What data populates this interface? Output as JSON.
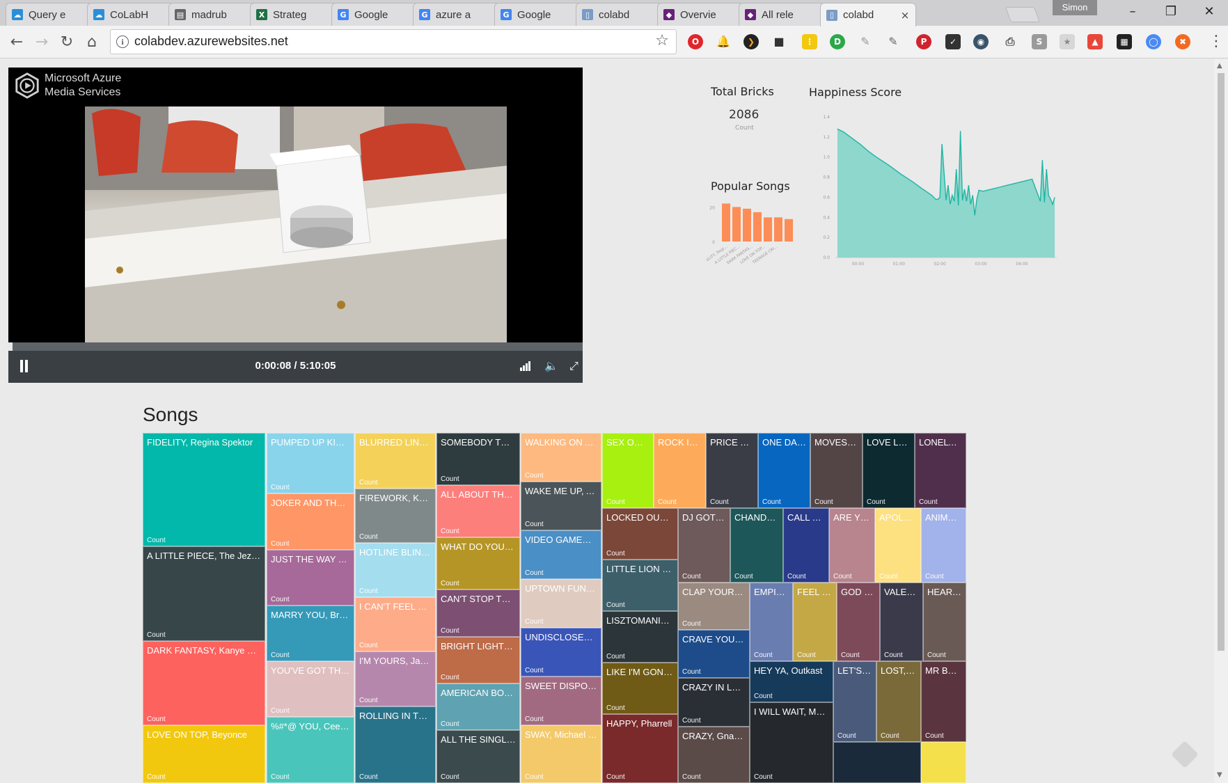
{
  "browser": {
    "tabs": [
      {
        "label": "Query e",
        "icon": "cloud-icon",
        "color": "#2a8fd8"
      },
      {
        "label": "CoLabH",
        "icon": "cloud-icon",
        "color": "#2a8fd8"
      },
      {
        "label": "madrub",
        "icon": "doc-icon",
        "color": "#666666"
      },
      {
        "label": "Strateg",
        "icon": "excel-icon",
        "color": "#1e7145"
      },
      {
        "label": "Google",
        "icon": "google-icon",
        "color": "#4285f4"
      },
      {
        "label": "azure a",
        "icon": "google-icon",
        "color": "#4285f4"
      },
      {
        "label": "Google",
        "icon": "google-icon",
        "color": "#4285f4"
      },
      {
        "label": "colabd",
        "icon": "page-icon",
        "color": "#7a9cc6"
      },
      {
        "label": "Overvie",
        "icon": "visual-studio-icon",
        "color": "#68217a"
      },
      {
        "label": "All rele",
        "icon": "visual-studio-icon",
        "color": "#68217a"
      },
      {
        "label": "colabd",
        "icon": "page-icon",
        "color": "#7a9cc6"
      }
    ],
    "profile_name": "Simon",
    "url": "colabdev.azurewebsites.net",
    "window_buttons": {
      "minimize": "–",
      "restore": "❐",
      "close": "✕"
    }
  },
  "player": {
    "brand_line1": "Microsoft Azure",
    "brand_line2": "Media Services",
    "time": "0:00:08 / 5:10:05",
    "progress_fraction": 0.007
  },
  "kpi": {
    "title": "Total Bricks",
    "value": "2086",
    "sub": "Count"
  },
  "popular_songs": {
    "title": "Popular Songs",
    "color": "#fd8d56"
  },
  "happiness": {
    "title": "Happiness Score",
    "color": "#7dd3c7"
  },
  "chart_data": [
    {
      "type": "bar",
      "title": "Popular Songs",
      "categories": [
        "FIDELITY, Regi...",
        "A LITTLE PIEC...",
        "DARK FANTAS...",
        "LOVE ON TOP...",
        "TEENAGE CRI..."
      ],
      "values": [
        22,
        20,
        19,
        17,
        14,
        14,
        13
      ],
      "ylim": [
        0,
        25
      ],
      "yticks": [
        "0",
        "20"
      ]
    },
    {
      "type": "area",
      "title": "Happiness Score",
      "ylim": [
        0,
        1.4
      ],
      "yticks": [
        "0.0",
        "0.2",
        "0.4",
        "0.6",
        "0.8",
        "1.0",
        "1.2",
        "1.4"
      ],
      "xticks": [
        "00:00",
        "01:00",
        "02:00",
        "03:00",
        "04:00"
      ],
      "x": [
        0.05,
        0.2,
        0.4,
        0.6,
        0.8,
        1.0,
        1.3,
        1.6,
        1.9,
        2.1,
        2.35,
        2.45,
        2.5,
        2.55,
        2.6,
        2.7,
        2.75,
        2.8,
        2.85,
        2.9,
        2.95,
        3.0,
        3.05,
        3.1,
        3.15,
        3.2,
        3.25,
        3.3,
        3.35,
        3.4,
        3.45,
        3.5,
        3.6,
        3.8,
        4.0,
        4.2,
        4.4,
        4.6,
        4.8,
        5.0,
        5.05,
        5.1,
        5.15,
        5.2,
        5.25,
        5.3,
        5.35
      ],
      "y": [
        1.28,
        1.25,
        1.19,
        1.13,
        1.06,
        1.0,
        0.92,
        0.83,
        0.75,
        0.69,
        0.62,
        0.58,
        0.58,
        0.6,
        1.13,
        0.57,
        0.72,
        0.53,
        0.62,
        0.56,
        0.88,
        0.52,
        1.26,
        0.57,
        0.68,
        0.56,
        0.72,
        0.53,
        0.62,
        0.42,
        0.58,
        0.67,
        0.66,
        0.68,
        0.7,
        0.72,
        0.74,
        0.76,
        0.78,
        0.56,
        0.97,
        0.55,
        0.88,
        0.62,
        0.58,
        0.53,
        0.6
      ]
    }
  ],
  "songs": {
    "title": "Songs",
    "count_label": "Count",
    "cells": [
      {
        "label": "FIDELITY, Regina Spektor",
        "color": "#01b8aa"
      },
      {
        "label": "A LITTLE PIECE, The Jezabels",
        "color": "#374649"
      },
      {
        "label": "DARK FANTASY, Kanye West",
        "color": "#fd625e"
      },
      {
        "label": "LOVE ON TOP, Beyonce",
        "color": "#f2c80f"
      },
      {
        "label": "PUMPED UP KICKS, F...",
        "color": "#8ad4eb"
      },
      {
        "label": "JOKER AND THE THIE...",
        "color": "#fe9666"
      },
      {
        "label": "JUST THE WAY YOU A...",
        "color": "#a66999"
      },
      {
        "label": "MARRY YOU, Bruno ...",
        "color": "#3599b8"
      },
      {
        "label": "YOU'VE GOT THE LOV...",
        "color": "#dfbfbf"
      },
      {
        "label": "%#*@ YOU, Cee Lo G...",
        "color": "#4ac5bb"
      },
      {
        "label": "BLURRED LINES, Ro...",
        "color": "#f4d25a"
      },
      {
        "label": "FIREWORK, Katy Per...",
        "color": "#7f898a"
      },
      {
        "label": "HOTLINE BLING, Dr...",
        "color": "#a4ddee"
      },
      {
        "label": "I CAN'T FEEL MY FA...",
        "color": "#fdab89"
      },
      {
        "label": "I'M YOURS, Jason ...",
        "color": "#b687ac"
      },
      {
        "label": "ROLLING IN THE DE...",
        "color": "#28738a"
      },
      {
        "label": "SOMEBODY THAT I ...",
        "color": "#2f3c3f"
      },
      {
        "label": "ALL ABOUT THAT BA...",
        "color": "#fd7f7c"
      },
      {
        "label": "WHAT DO YOU MEA...",
        "color": "#b59525"
      },
      {
        "label": "CAN'T STOP THIS FE...",
        "color": "#7c4f73"
      },
      {
        "label": "BRIGHT LIGHTS BIG...",
        "color": "#be6b48"
      },
      {
        "label": "AMERICAN BOY, Est...",
        "color": "#5fa2b1"
      },
      {
        "label": "ALL THE SINGLE LAD...",
        "color": "#3b4a4d"
      },
      {
        "label": "WALKING ON A DR...",
        "color": "#fdb97f"
      },
      {
        "label": "WAKE ME UP, Avicii",
        "color": "#4b5559"
      },
      {
        "label": "VIDEO GAMES, Lan...",
        "color": "#4a8fc6"
      },
      {
        "label": "UPTOWN FUNK, Ma...",
        "color": "#dfcbbf"
      },
      {
        "label": "UNDISCLOSED DESI...",
        "color": "#3a55b8"
      },
      {
        "label": "SWEET DISPOSITIO...",
        "color": "#a26a80"
      },
      {
        "label": "SWAY, Michael Buble",
        "color": "#f3c96a"
      },
      {
        "label": "SEX ON FIR...",
        "color": "#a8f00f"
      },
      {
        "label": "ROCK IT, Li...",
        "color": "#fdab5a"
      },
      {
        "label": "PRICE TAG, ...",
        "color": "#3a3d45"
      },
      {
        "label": "ONE DANC...",
        "color": "#0766c0"
      },
      {
        "label": "MOVES LIK...",
        "color": "#534546"
      },
      {
        "label": "LOVE LOST,...",
        "color": "#0d2a30"
      },
      {
        "label": "LONELY BO...",
        "color": "#502f4c"
      },
      {
        "label": "LOCKED OUT OF ...",
        "color": "#7b4739"
      },
      {
        "label": "LITTLE LION MAN,...",
        "color": "#3d5f6a"
      },
      {
        "label": "LISZTOMANIA, Ph...",
        "color": "#2c3539"
      },
      {
        "label": "LIKE I'M GONNA L...",
        "color": "#6f5b16"
      },
      {
        "label": "HAPPY, Pharrell",
        "color": "#7a2a2a"
      },
      {
        "label": "DJ GOT US ...",
        "color": "#6e5a5a"
      },
      {
        "label": "CHANDELI...",
        "color": "#1e5759"
      },
      {
        "label": "CALL ME ...",
        "color": "#2a3a8a"
      },
      {
        "label": "ARE YOU ...",
        "color": "#b8848e"
      },
      {
        "label": "APOLOGI...",
        "color": "#fde07f"
      },
      {
        "label": "ANIMAL, ...",
        "color": "#a2b2ea"
      },
      {
        "label": "CLAP YOUR HAN...",
        "color": "#9a8a80"
      },
      {
        "label": "CRAVE YOU, Flig...",
        "color": "#1e4c8a"
      },
      {
        "label": "CRAZY IN LOVE, ...",
        "color": "#2a2f36"
      },
      {
        "label": "CRAZY, Gnarles B...",
        "color": "#5a4a48"
      },
      {
        "label": "EMPIRE ...",
        "color": "#6a7db0"
      },
      {
        "label": "FEEL SO ...",
        "color": "#c4a845"
      },
      {
        "label": "GOD PU...",
        "color": "#7d4a5a"
      },
      {
        "label": "VALERIE,...",
        "color": "#3a3a4a"
      },
      {
        "label": "HEARTB...",
        "color": "#6a5a55"
      },
      {
        "label": "HEY YA, Outkast",
        "color": "#163a5a"
      },
      {
        "label": "I WILL WAIT, Mumfo...",
        "color": "#25292d"
      },
      {
        "label": "LET'S GE...",
        "color": "#4a5a7a"
      },
      {
        "label": "LOST, Fra...",
        "color": "#7a6a3a"
      },
      {
        "label": "MR BRIG...",
        "color": "#5a3540"
      },
      {
        "label": "",
        "color": "#1a2a3a"
      },
      {
        "label": "",
        "color": "#f4e04a"
      }
    ]
  }
}
